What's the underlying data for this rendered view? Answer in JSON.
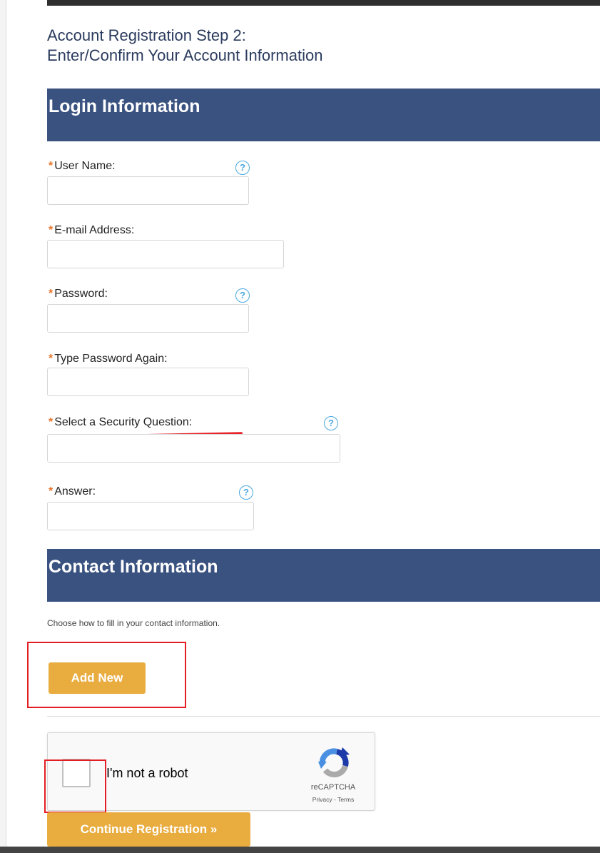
{
  "page": {
    "title_line1": "Account Registration Step 2:",
    "title_line2": "Enter/Confirm Your Account Information"
  },
  "login_section": {
    "header": "Login Information",
    "required_mark": "*",
    "help_symbol": "?",
    "fields": {
      "username": {
        "label": "User Name:",
        "value": ""
      },
      "email": {
        "label": "E-mail Address:",
        "value": ""
      },
      "password": {
        "label": "Password:",
        "value": ""
      },
      "password_again": {
        "label": "Type Password Again:",
        "value": ""
      },
      "security_question": {
        "label": "Select a Security Question:",
        "value": ""
      },
      "answer": {
        "label": "Answer:",
        "value": ""
      }
    }
  },
  "contact_section": {
    "header": "Contact Information",
    "hint": "Choose how to fill in your contact information.",
    "add_new_label": "Add New"
  },
  "recaptcha": {
    "label": "I'm not a robot",
    "brand": "reCAPTCHA",
    "privacy": "Privacy",
    "separator": " - ",
    "terms": "Terms",
    "checked": false
  },
  "actions": {
    "continue_label": "Continue Registration »"
  },
  "colors": {
    "section_header_bg": "#3a5280",
    "title_text": "#2b3b5e",
    "required_mark": "#e8742b",
    "button_bg": "#e9ac3f",
    "help_icon": "#4aa8e0",
    "annotation_red": "#e31e24"
  },
  "icons": {
    "help": "question-circle-icon",
    "recaptcha": "recaptcha-logo-icon"
  }
}
